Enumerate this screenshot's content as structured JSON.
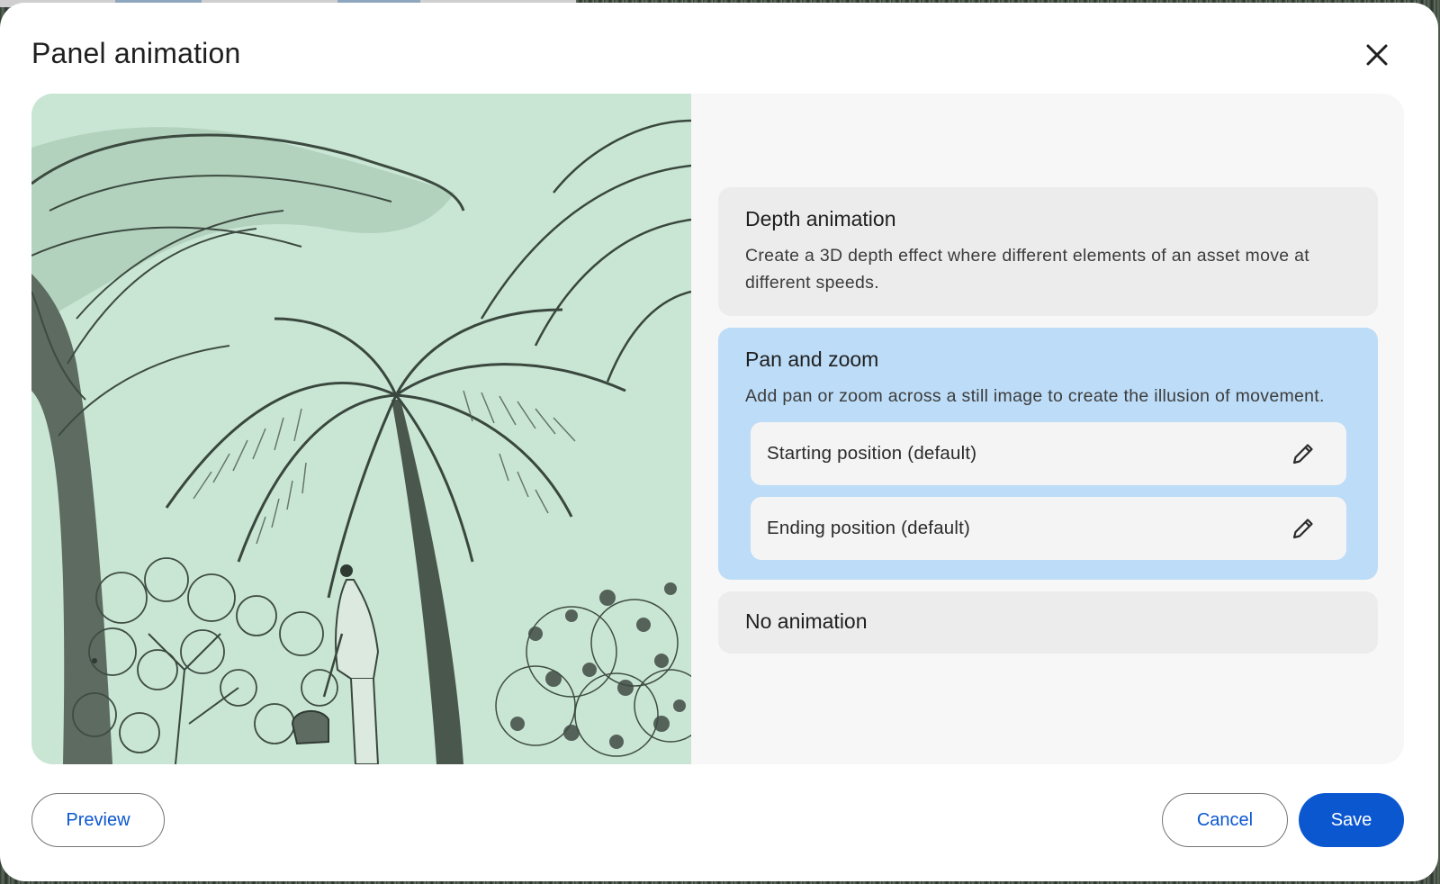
{
  "dialog": {
    "title": "Panel animation",
    "close_icon": "close-icon"
  },
  "preview_image": {
    "description_icon": "image"
  },
  "options": {
    "depth": {
      "title": "Depth animation",
      "description": "Create a 3D depth effect where different elements of an asset move at different speeds."
    },
    "pan_zoom": {
      "title": "Pan and zoom",
      "description": "Add pan or zoom across a still image to create the illusion of movement.",
      "selected": true,
      "positions": [
        {
          "label": "Starting position (default)",
          "icon": "pencil-icon"
        },
        {
          "label": "Ending position (default)",
          "icon": "pencil-icon"
        }
      ]
    },
    "none": {
      "title": "No animation"
    }
  },
  "footer": {
    "preview_label": "Preview",
    "cancel_label": "Cancel",
    "save_label": "Save"
  },
  "colors": {
    "accent": "#0b57d0",
    "selected_card": "#bcdcf7",
    "card": "#ececec",
    "image_tint": "#c9e6d4"
  }
}
